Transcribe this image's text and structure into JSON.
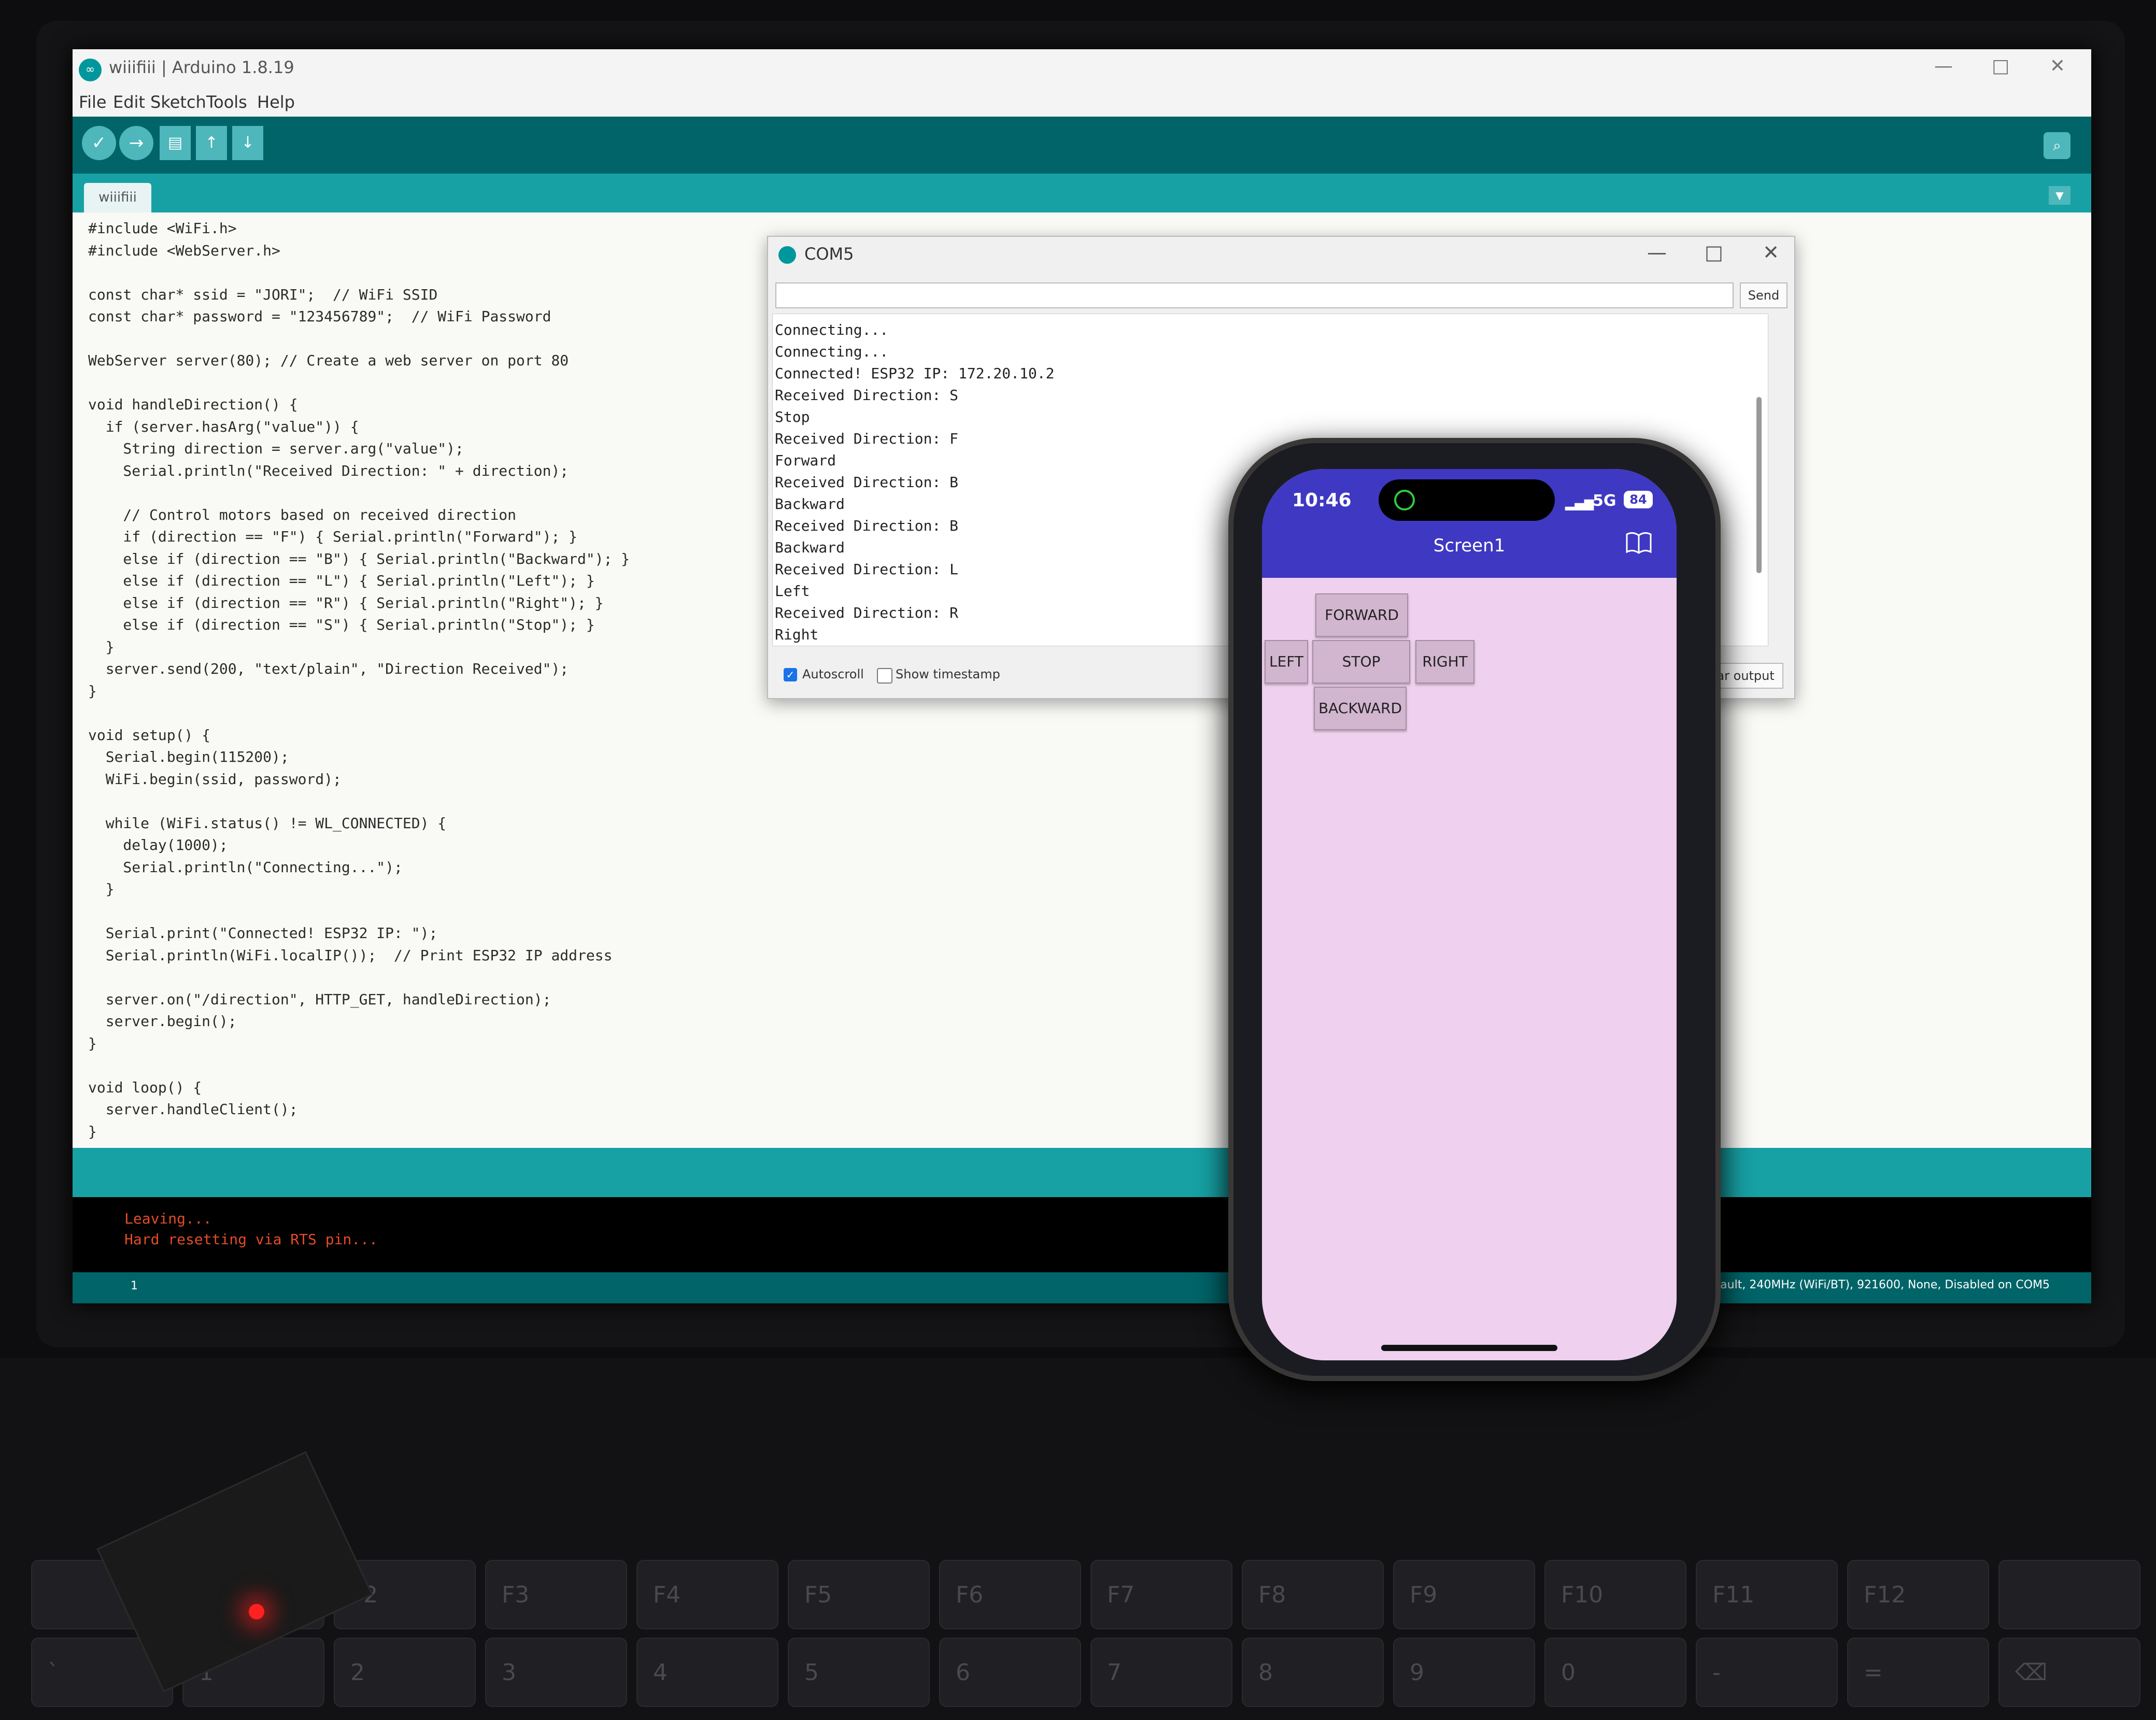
{
  "window": {
    "title": "wiiifiii | Arduino 1.8.19",
    "minimize": "—",
    "maximize": "□",
    "close": "✕"
  },
  "menu": [
    "File",
    "Edit",
    "Sketch",
    "Tools",
    "Help"
  ],
  "toolbar": {
    "verify_icon": "✓",
    "upload_icon": "→",
    "new_icon": "▤",
    "open_icon": "↑",
    "save_icon": "↓",
    "serial_icon": "⌕"
  },
  "tabs": {
    "sketch_name": "wiiifiii",
    "menu_icon": "▼"
  },
  "code": [
    "#include <WiFi.h>",
    "#include <WebServer.h>",
    "",
    "const char* ssid = \"JORI\";  // WiFi SSID",
    "const char* password = \"123456789\";  // WiFi Password",
    "",
    "WebServer server(80); // Create a web server on port 80",
    "",
    "void handleDirection() {",
    "  if (server.hasArg(\"value\")) {",
    "    String direction = server.arg(\"value\");",
    "    Serial.println(\"Received Direction: \" + direction);",
    "",
    "    // Control motors based on received direction",
    "    if (direction == \"F\") { Serial.println(\"Forward\"); }",
    "    else if (direction == \"B\") { Serial.println(\"Backward\"); }",
    "    else if (direction == \"L\") { Serial.println(\"Left\"); }",
    "    else if (direction == \"R\") { Serial.println(\"Right\"); }",
    "    else if (direction == \"S\") { Serial.println(\"Stop\"); }",
    "  }",
    "  server.send(200, \"text/plain\", \"Direction Received\");",
    "}",
    "",
    "void setup() {",
    "  Serial.begin(115200);",
    "  WiFi.begin(ssid, password);",
    "",
    "  while (WiFi.status() != WL_CONNECTED) {",
    "    delay(1000);",
    "    Serial.println(\"Connecting...\");",
    "  }",
    "",
    "  Serial.print(\"Connected! ESP32 IP: \");",
    "  Serial.println(WiFi.localIP());  // Print ESP32 IP address",
    "",
    "  server.on(\"/direction\", HTTP_GET, handleDirection);",
    "  server.begin();",
    "}",
    "",
    "void loop() {",
    "  server.handleClient();",
    "}"
  ],
  "console": [
    "Leaving...",
    "Hard resetting via RTS pin..."
  ],
  "status_bar": {
    "line": "1",
    "board": "Default, 240MHz (WiFi/BT), 921600, None, Disabled on COM5"
  },
  "serial_monitor": {
    "title": "COM5",
    "send_label": "Send",
    "output": [
      "Connecting...",
      "Connecting...",
      "Connected! ESP32 IP: 172.20.10.2",
      "Received Direction: S",
      "Stop",
      "Received Direction: F",
      "Forward",
      "Received Direction: B",
      "Backward",
      "Received Direction: B",
      "Backward",
      "Received Direction: L",
      "Left",
      "Received Direction: R",
      "Right"
    ],
    "autoscroll_label": "Autoscroll",
    "autoscroll_checked": true,
    "timestamp_label": "Show timestamp",
    "timestamp_checked": false,
    "clear_label": "Clear output"
  },
  "phone": {
    "time": "10:46",
    "network": "5G",
    "battery": "84",
    "screen_title": "Screen1",
    "buttons": {
      "forward": "FORWARD",
      "left": "LEFT",
      "stop": "STOP",
      "right": "RIGHT",
      "backward": "BACKWARD"
    },
    "colors": {
      "app_bar": "#3f38c2",
      "background": "#efd0ee",
      "button": "#d2b5cf"
    }
  },
  "colors": {
    "arduino_teal": "#00979c",
    "toolbar_dark": "#006468",
    "console_text": "#e34c26",
    "board_led": "#ff2020"
  }
}
